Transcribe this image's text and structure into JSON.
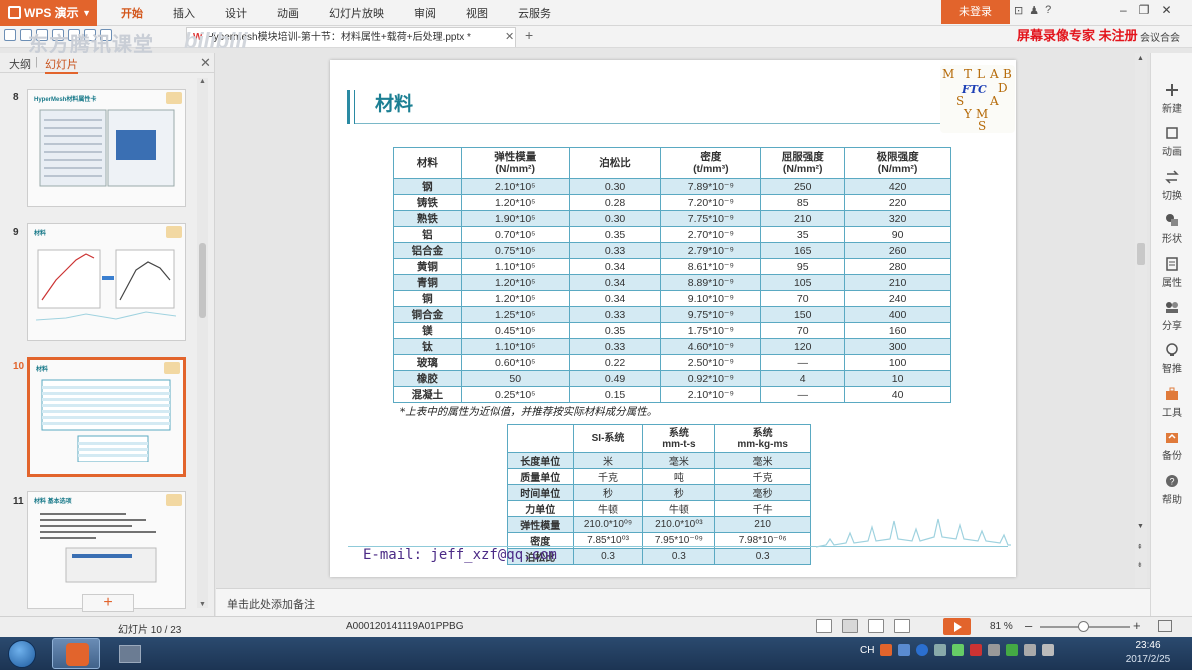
{
  "app": {
    "name": "WPS 演示",
    "menu_tabs": [
      "开始",
      "插入",
      "设计",
      "动画",
      "幻灯片放映",
      "审阅",
      "视图",
      "云服务"
    ],
    "active_tab": "开始",
    "login_label": "未登录",
    "help_mark": "?"
  },
  "document_tab": {
    "label": "Hypermesh模块培训-第十节：材料属性+载荷+后处理.pptx *",
    "wps_icon": "W"
  },
  "watermarks": {
    "left": "东方腾讯课堂",
    "bili": "bilibili",
    "register": "屏幕录像专家 未注册",
    "extra": "会议合会"
  },
  "left_panel": {
    "tab_outline": "大纲",
    "tab_slides": "幻灯片",
    "thumbnails": [
      {
        "number": "8",
        "title": "HyperMesh材料属性卡"
      },
      {
        "number": "9",
        "title": "材料"
      },
      {
        "number": "10",
        "title": "材料"
      },
      {
        "number": "11",
        "title": "材料 基本选项"
      }
    ],
    "active_slide": "10",
    "add_label": "+"
  },
  "slide": {
    "title": "材料",
    "logo_letters": [
      "M",
      "T",
      "L",
      "A",
      "B",
      "D",
      "A",
      "S",
      "Y",
      "M",
      "S"
    ],
    "logo_center": "FTC",
    "table1": {
      "headers": [
        "材料",
        "弹性模量\n(N/mm²)",
        "泊松比",
        "密度\n(t/mm³)",
        "屈服强度\n(N/mm²)",
        "极限强度\n(N/mm²)"
      ],
      "rows": [
        [
          "钢",
          "2.10*10⁵",
          "0.30",
          "7.89*10⁻⁹",
          "250",
          "420"
        ],
        [
          "铸铁",
          "1.20*10⁵",
          "0.28",
          "7.20*10⁻⁹",
          "85",
          "220"
        ],
        [
          "熟铁",
          "1.90*10⁵",
          "0.30",
          "7.75*10⁻⁹",
          "210",
          "320"
        ],
        [
          "铝",
          "0.70*10⁵",
          "0.35",
          "2.70*10⁻⁹",
          "35",
          "90"
        ],
        [
          "铝合金",
          "0.75*10⁵",
          "0.33",
          "2.79*10⁻⁹",
          "165",
          "260"
        ],
        [
          "黄铜",
          "1.10*10⁵",
          "0.34",
          "8.61*10⁻⁹",
          "95",
          "280"
        ],
        [
          "青铜",
          "1.20*10⁵",
          "0.34",
          "8.89*10⁻⁹",
          "105",
          "210"
        ],
        [
          "铜",
          "1.20*10⁵",
          "0.34",
          "9.10*10⁻⁹",
          "70",
          "240"
        ],
        [
          "铜合金",
          "1.25*10⁵",
          "0.33",
          "9.75*10⁻⁹",
          "150",
          "400"
        ],
        [
          "镁",
          "0.45*10⁵",
          "0.35",
          "1.75*10⁻⁹",
          "70",
          "160"
        ],
        [
          "钛",
          "1.10*10⁵",
          "0.33",
          "4.60*10⁻⁹",
          "120",
          "300"
        ],
        [
          "玻璃",
          "0.60*10⁵",
          "0.22",
          "2.50*10⁻⁹",
          "—",
          "100"
        ],
        [
          "橡胶",
          "50",
          "0.49",
          "0.92*10⁻⁹",
          "4",
          "10"
        ],
        [
          "混凝土",
          "0.25*10⁵",
          "0.15",
          "2.10*10⁻⁹",
          "—",
          "40"
        ]
      ]
    },
    "note": "*上表中的属性为近似值，并推荐按实际材料成分属性。",
    "table2": {
      "headers": [
        "",
        "SI-系统",
        "系统\nmm-t-s",
        "系统\nmm-kg-ms"
      ],
      "rows": [
        [
          "长度单位",
          "米",
          "毫米",
          "毫米"
        ],
        [
          "质量单位",
          "千克",
          "吨",
          "千克"
        ],
        [
          "时间单位",
          "秒",
          "秒",
          "毫秒"
        ],
        [
          "力单位",
          "牛顿",
          "牛顿",
          "千牛"
        ],
        [
          "弹性模量",
          "210.0*10⁰⁹",
          "210.0*10⁰³",
          "210"
        ],
        [
          "密度",
          "7.85*10⁰³",
          "7.95*10⁻⁰⁹",
          "7.98*10⁻⁰⁶"
        ],
        [
          "泊松比",
          "0.3",
          "0.3",
          "0.3"
        ]
      ]
    },
    "email": "E-mail: jeff_xzf@qq.com"
  },
  "right_panel": [
    "新建",
    "动画",
    "切换",
    "形状",
    "属性",
    "分享",
    "智推",
    "工具",
    "备份",
    "帮助"
  ],
  "notes_placeholder": "单击此处添加备注",
  "status": {
    "slide_counter": "幻灯片 10 / 23",
    "theme_code": "A000120141119A01PPBG",
    "zoom": "81 %",
    "zoom_level": 0.48
  },
  "taskbar": {
    "lang": "CH",
    "time": "23:46",
    "date": "2017/2/25"
  },
  "colors": {
    "accent": "#e2642c",
    "title_teal": "#1c7f93",
    "table_stripe": "#d4eaf3",
    "table_border": "#5aa9c2"
  }
}
